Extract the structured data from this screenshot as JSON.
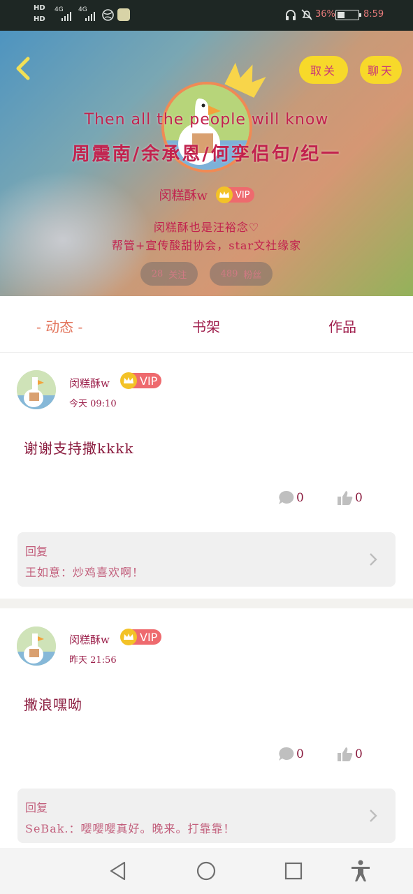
{
  "status_bar": {
    "sim1": "HD",
    "sim2": "HD",
    "net1": "4G",
    "net2": "4G",
    "battery_pct": "36%",
    "battery_level": 0.36,
    "time": "8:59"
  },
  "header": {
    "unfollow_label": "取关",
    "chat_label": "聊天",
    "motto_en": "Then all the people will know",
    "motto_cn": "周震南/余承恩/何孪侣句/纪一",
    "username": "闵糕酥w",
    "vip_label": "VIP",
    "bio_line1": "闵糕酥也是汪裕念♡",
    "bio_line2": "帮管+宣传酸甜协会，star文社缘家",
    "following_count": "28",
    "following_label": "关注",
    "fans_count": "489",
    "fans_label": "粉丝"
  },
  "tabs": [
    {
      "label": "- 动态 -",
      "active": true
    },
    {
      "label": "书架",
      "active": false
    },
    {
      "label": "作品",
      "active": false
    }
  ],
  "posts": [
    {
      "author": "闵糕酥w",
      "vip": "VIP",
      "time": "今天 09:10",
      "text": "谢谢支持撒kkkk",
      "comments": "0",
      "likes": "0",
      "reply_label": "回复",
      "reply_text": "王如意：炒鸡喜欢啊！"
    },
    {
      "author": "闵糕酥w",
      "vip": "VIP",
      "time": "昨天 21:56",
      "text": "撒浪嘿呦",
      "comments": "0",
      "likes": "0",
      "reply_label": "回复",
      "reply_text": "SeBak.：嘤嘤嘤真好。晚来。打靠靠！"
    }
  ],
  "colors": {
    "accent_yellow": "#f7d92a",
    "text_maroon": "#8a1b3e",
    "tab_active": "#e2735a",
    "vip_red": "#ee6a6e"
  }
}
